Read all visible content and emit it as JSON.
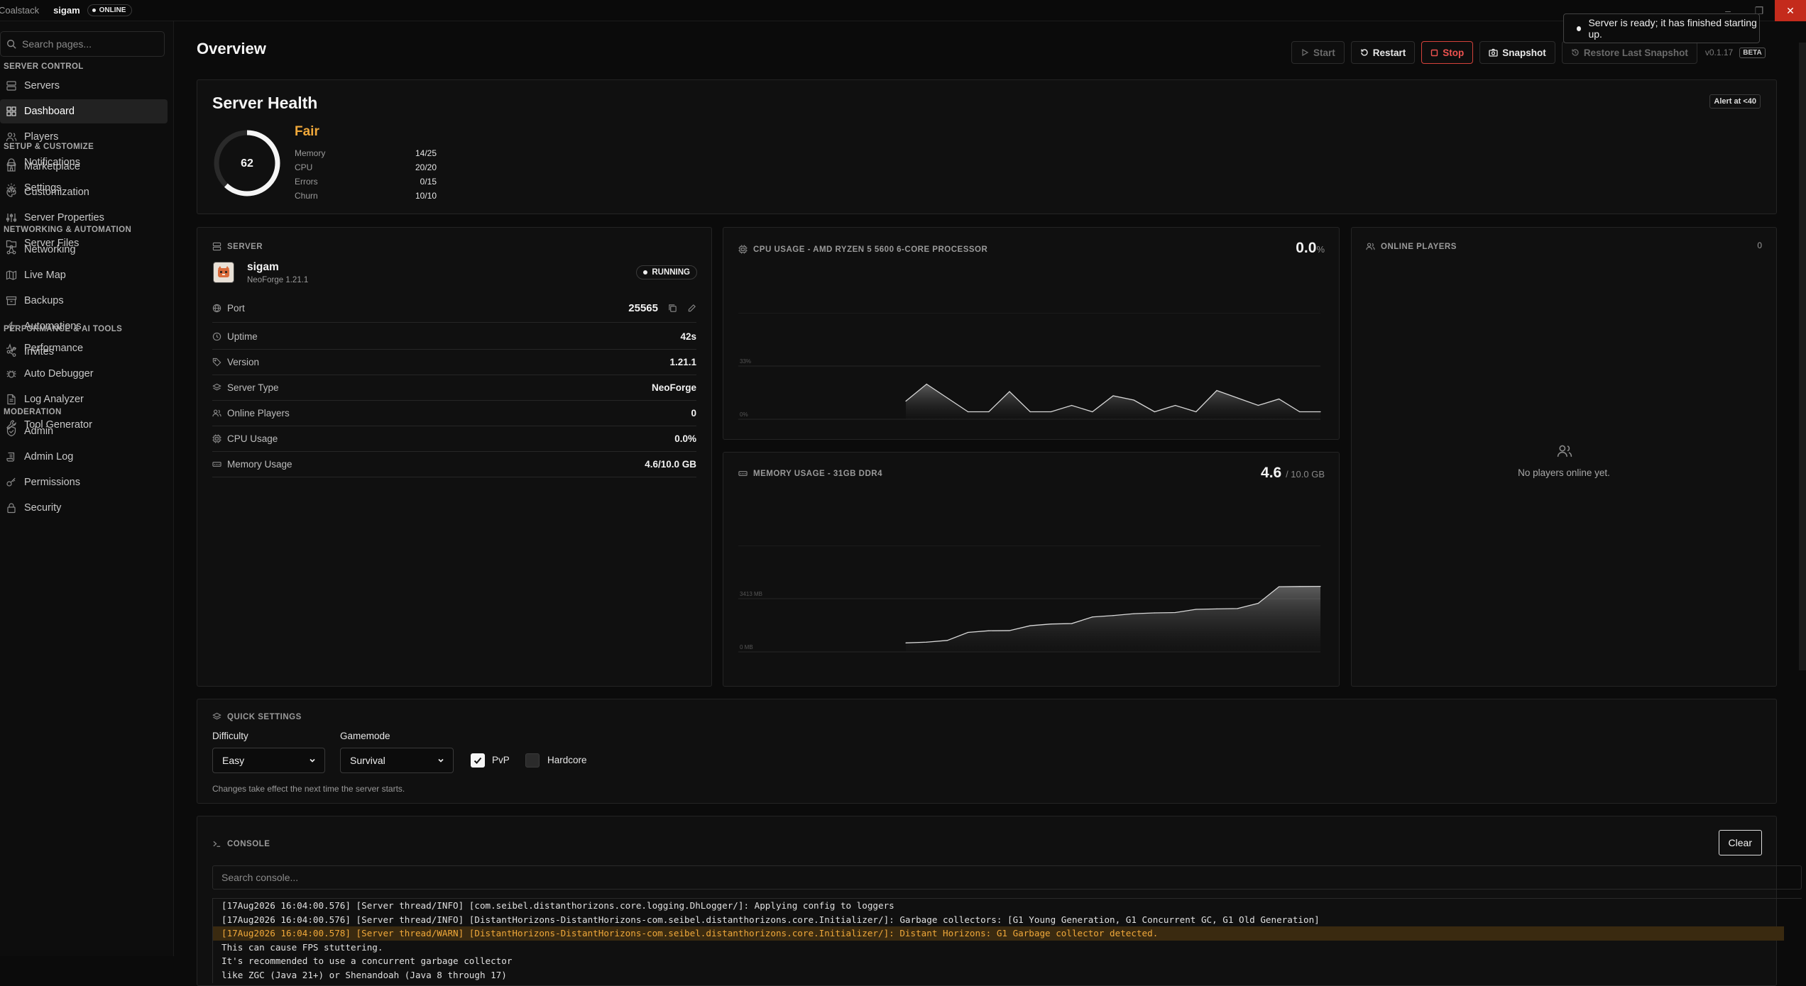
{
  "titlebar": {
    "app": "Coalstack",
    "server": "sigam",
    "status": "ONLINE"
  },
  "sidebar": {
    "search_placeholder": "Search pages...",
    "sections": [
      {
        "title": "SERVER CONTROL",
        "items": [
          {
            "label": "Servers",
            "icon": "servers-icon"
          },
          {
            "label": "Dashboard",
            "icon": "dashboard-icon",
            "active": true
          },
          {
            "label": "Players",
            "icon": "players-icon"
          },
          {
            "label": "Notifications",
            "icon": "bell-icon"
          },
          {
            "label": "Settings",
            "icon": "gear-icon"
          }
        ]
      },
      {
        "title": "SETUP & CUSTOMIZE",
        "items": [
          {
            "label": "Marketplace",
            "icon": "store-icon"
          },
          {
            "label": "Customization",
            "icon": "palette-icon"
          },
          {
            "label": "Server Properties",
            "icon": "sliders-icon"
          },
          {
            "label": "Server Files",
            "icon": "folder-icon"
          }
        ]
      },
      {
        "title": "NETWORKING & AUTOMATION",
        "items": [
          {
            "label": "Networking",
            "icon": "network-icon"
          },
          {
            "label": "Live Map",
            "icon": "map-icon"
          },
          {
            "label": "Backups",
            "icon": "archive-icon"
          },
          {
            "label": "Automations",
            "icon": "bolt-icon"
          },
          {
            "label": "Invites",
            "icon": "share-icon"
          }
        ]
      },
      {
        "title": "PERFORMANCE & AI TOOLS",
        "items": [
          {
            "label": "Performance",
            "icon": "pulse-icon"
          },
          {
            "label": "Auto Debugger",
            "icon": "bug-icon"
          },
          {
            "label": "Log Analyzer",
            "icon": "file-text-icon"
          },
          {
            "label": "Tool Generator",
            "icon": "wrench-icon"
          }
        ]
      },
      {
        "title": "MODERATION",
        "items": [
          {
            "label": "Admin",
            "icon": "shield-icon"
          },
          {
            "label": "Admin Log",
            "icon": "scroll-icon"
          },
          {
            "label": "Permissions",
            "icon": "key-icon"
          },
          {
            "label": "Security",
            "icon": "lock-icon"
          }
        ]
      }
    ]
  },
  "header": {
    "title": "Overview"
  },
  "toolbar": {
    "start": "Start",
    "restart": "Restart",
    "stop": "Stop",
    "snapshot": "Snapshot",
    "restore": "Restore Last Snapshot",
    "version": "v0.1.17",
    "beta": "BETA"
  },
  "toast": {
    "message": "Server is ready; it has finished starting up."
  },
  "health": {
    "title": "Server Health",
    "score": "62",
    "score_fraction": 0.62,
    "grade": "Fair",
    "alert": "Alert at <40",
    "metrics": [
      {
        "label": "Memory",
        "value": "14/25"
      },
      {
        "label": "CPU",
        "value": "20/20"
      },
      {
        "label": "Errors",
        "value": "0/15"
      },
      {
        "label": "Churn",
        "value": "10/10"
      }
    ]
  },
  "server": {
    "header": "SERVER",
    "name": "sigam",
    "subtitle": "NeoForge 1.21.1",
    "status": "RUNNING",
    "rows": [
      {
        "label": "Port",
        "value": "25565",
        "icon": "globe-icon"
      },
      {
        "label": "Uptime",
        "value": "42s",
        "icon": "clock-icon"
      },
      {
        "label": "Version",
        "value": "1.21.1",
        "icon": "tag-icon"
      },
      {
        "label": "Server Type",
        "value": "NeoForge",
        "icon": "layers-icon"
      },
      {
        "label": "Online Players",
        "value": "0",
        "icon": "users-icon"
      },
      {
        "label": "CPU Usage",
        "value": "0.0%",
        "icon": "cpu-icon"
      },
      {
        "label": "Memory Usage",
        "value": "4.6/10.0 GB",
        "icon": "memory-icon"
      }
    ]
  },
  "cpu": {
    "header": "CPU USAGE - AMD RYZEN 5 5600 6-CORE PROCESSOR",
    "value": "0.0",
    "unit": "%"
  },
  "memory": {
    "header": "MEMORY USAGE - 31GB DDR4",
    "value": "4.6",
    "unit": "/ 10.0 GB"
  },
  "chart_data": [
    {
      "type": "area",
      "title": "CPU USAGE - AMD RYZEN 5 5600 6-CORE PROCESSOR",
      "yticks": [
        "67%",
        "33%",
        "0%"
      ],
      "ylim": [
        0,
        100
      ],
      "values": [
        17,
        33,
        20,
        7,
        7,
        26,
        7,
        7,
        13,
        7,
        22,
        18,
        7,
        13,
        7,
        27,
        20,
        13,
        19,
        7,
        7
      ]
    },
    {
      "type": "area",
      "title": "MEMORY USAGE - 31GB DDR4",
      "yticks": [
        "6827 MB",
        "3413 MB",
        "0 MB"
      ],
      "ylim": [
        0,
        10240
      ],
      "values": [
        865,
        937,
        1104,
        1880,
        2034,
        2051,
        2522,
        2683,
        2727,
        3362,
        3498,
        3677,
        3753,
        3787,
        4097,
        4140,
        4171,
        4676,
        6271,
        6295,
        6305
      ]
    }
  ],
  "players": {
    "header": "ONLINE PLAYERS",
    "count": "0",
    "empty": "No players online yet."
  },
  "quick_settings": {
    "header": "QUICK SETTINGS",
    "difficulty_label": "Difficulty",
    "difficulty": "Easy",
    "gamemode_label": "Gamemode",
    "gamemode": "Survival",
    "pvp_label": "PvP",
    "pvp": true,
    "hardcore_label": "Hardcore",
    "hardcore": false,
    "note": "Changes take effect the next time the server starts."
  },
  "console": {
    "header": "CONSOLE",
    "clear": "Clear",
    "search_placeholder": "Search console...",
    "lines": [
      {
        "text": "[17Aug2026 16:04:00.576] [Server thread/INFO] [com.seibel.distanthorizons.core.logging.DhLogger/]: Applying config to loggers",
        "level": "info"
      },
      {
        "text": "[17Aug2026 16:04:00.576] [Server thread/INFO] [DistantHorizons-DistantHorizons-com.seibel.distanthorizons.core.Initializer/]: Garbage collectors: [G1 Young Generation, G1 Concurrent GC, G1 Old Generation]",
        "level": "info"
      },
      {
        "text": "[17Aug2026 16:04:00.578] [Server thread/WARN] [DistantHorizons-DistantHorizons-com.seibel.distanthorizons.core.Initializer/]: Distant Horizons: G1 Garbage collector detected.",
        "level": "warn"
      },
      {
        "text": "This can cause FPS stuttering.",
        "level": "info"
      },
      {
        "text": "It's recommended to use a concurrent garbage collector",
        "level": "info"
      },
      {
        "text": "like ZGC (Java 21+) or Shenandoah (Java 8 through 17)",
        "level": "info"
      }
    ]
  }
}
